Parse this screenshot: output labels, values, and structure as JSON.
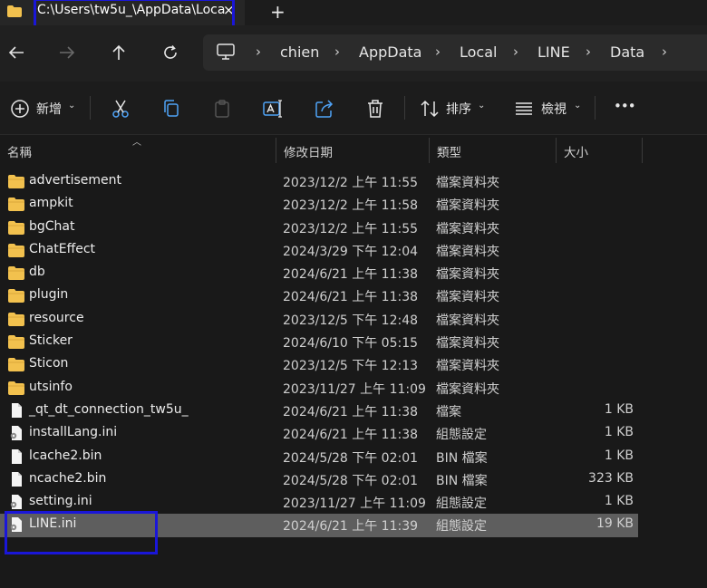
{
  "tab": {
    "title": "C:\\Users\\tw5u_\\AppData\\Loca",
    "close": "×",
    "new_tab": "+"
  },
  "breadcrumbs": [
    "chien",
    "AppData",
    "Local",
    "LINE",
    "Data"
  ],
  "commands": {
    "new_label": "新增",
    "sort_label": "排序",
    "view_label": "檢視",
    "more_label": "•••"
  },
  "columns": {
    "name": "名稱",
    "date": "修改日期",
    "type": "類型",
    "size": "大小"
  },
  "files": [
    {
      "name": "advertisement",
      "date": "2023/12/2 上午 11:55",
      "type": "檔案資料夾",
      "size": "",
      "icon": "folder-icon"
    },
    {
      "name": "ampkit",
      "date": "2023/12/2 上午 11:58",
      "type": "檔案資料夾",
      "size": "",
      "icon": "folder-icon"
    },
    {
      "name": "bgChat",
      "date": "2023/12/2 上午 11:55",
      "type": "檔案資料夾",
      "size": "",
      "icon": "folder-icon"
    },
    {
      "name": "ChatEffect",
      "date": "2024/3/29 下午 12:04",
      "type": "檔案資料夾",
      "size": "",
      "icon": "folder-icon"
    },
    {
      "name": "db",
      "date": "2024/6/21 上午 11:38",
      "type": "檔案資料夾",
      "size": "",
      "icon": "folder-icon"
    },
    {
      "name": "plugin",
      "date": "2024/6/21 上午 11:38",
      "type": "檔案資料夾",
      "size": "",
      "icon": "folder-icon"
    },
    {
      "name": "resource",
      "date": "2023/12/5 下午 12:48",
      "type": "檔案資料夾",
      "size": "",
      "icon": "folder-icon"
    },
    {
      "name": "Sticker",
      "date": "2024/6/10 下午 05:15",
      "type": "檔案資料夾",
      "size": "",
      "icon": "folder-icon"
    },
    {
      "name": "Sticon",
      "date": "2023/12/5 下午 12:13",
      "type": "檔案資料夾",
      "size": "",
      "icon": "folder-icon"
    },
    {
      "name": "utsinfo",
      "date": "2023/11/27 上午 11:09",
      "type": "檔案資料夾",
      "size": "",
      "icon": "folder-icon"
    },
    {
      "name": "_qt_dt_connection_tw5u_",
      "date": "2024/6/21 上午 11:38",
      "type": "檔案",
      "size": "1 KB",
      "icon": "file-icon"
    },
    {
      "name": "installLang.ini",
      "date": "2024/6/21 上午 11:38",
      "type": "組態設定",
      "size": "1 KB",
      "icon": "settings-file-icon"
    },
    {
      "name": "lcache2.bin",
      "date": "2024/5/28 下午 02:01",
      "type": "BIN 檔案",
      "size": "1 KB",
      "icon": "file-icon"
    },
    {
      "name": "ncache2.bin",
      "date": "2024/5/28 下午 02:01",
      "type": "BIN 檔案",
      "size": "323 KB",
      "icon": "file-icon"
    },
    {
      "name": "setting.ini",
      "date": "2023/11/27 上午 11:09",
      "type": "組態設定",
      "size": "1 KB",
      "icon": "settings-file-icon"
    },
    {
      "name": "LINE.ini",
      "date": "2024/6/21 上午 11:39",
      "type": "組態設定",
      "size": "19 KB",
      "icon": "settings-file-icon",
      "selected": true
    }
  ],
  "colors": {
    "highlight_box": "#1a16d8",
    "folder": "#f2c14e",
    "selected_row": "#5e5e5e"
  }
}
